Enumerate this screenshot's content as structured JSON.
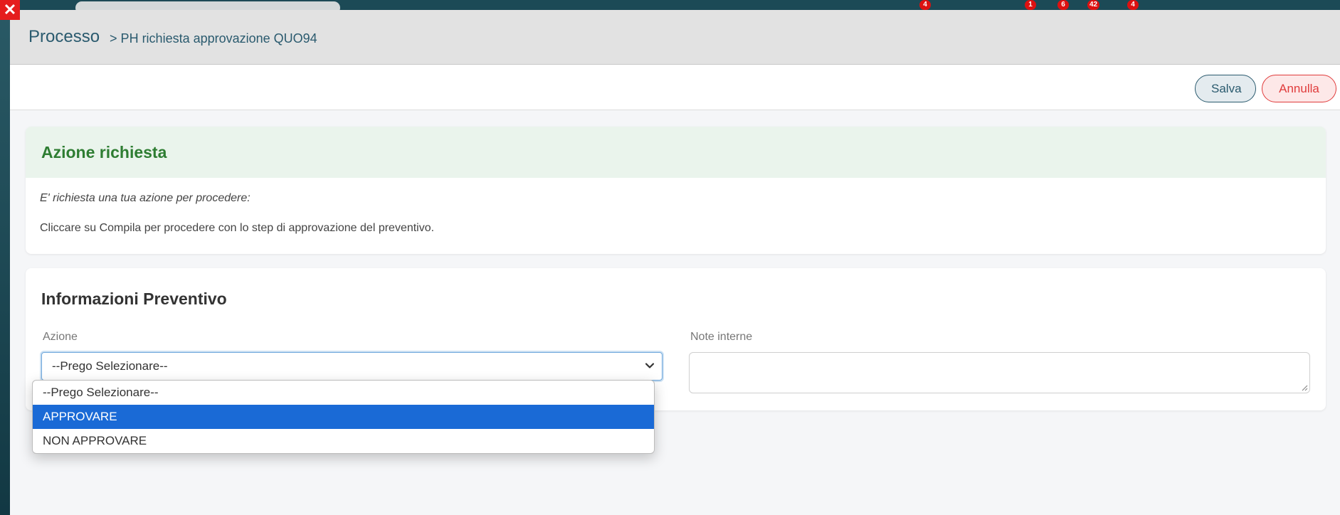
{
  "background": {
    "badges": [
      "4",
      "1",
      "6",
      "42",
      "4"
    ]
  },
  "modal": {
    "title": "Processo",
    "breadcrumb": "> PH richiesta approvazione QUO94",
    "buttons": {
      "save": "Salva",
      "cancel": "Annulla"
    }
  },
  "action_card": {
    "title": "Azione richiesta",
    "line1": "E' richiesta una tua azione per procedere:",
    "line2": "Cliccare su Compila per procedere con lo step di approvazione del preventivo."
  },
  "info_card": {
    "title": "Informazioni Preventivo",
    "azione_label": "Azione",
    "azione_value": "--Prego Selezionare--",
    "note_label": "Note interne",
    "note_value": ""
  },
  "dropdown": {
    "options": [
      "--Prego Selezionare--",
      "APPROVARE",
      "NON APPROVARE"
    ],
    "highlighted": "APPROVARE"
  },
  "colors": {
    "accent": "#2a5a6e",
    "success": "#2e7d32",
    "danger": "#e03b3b",
    "selection": "#1a6ad6"
  }
}
